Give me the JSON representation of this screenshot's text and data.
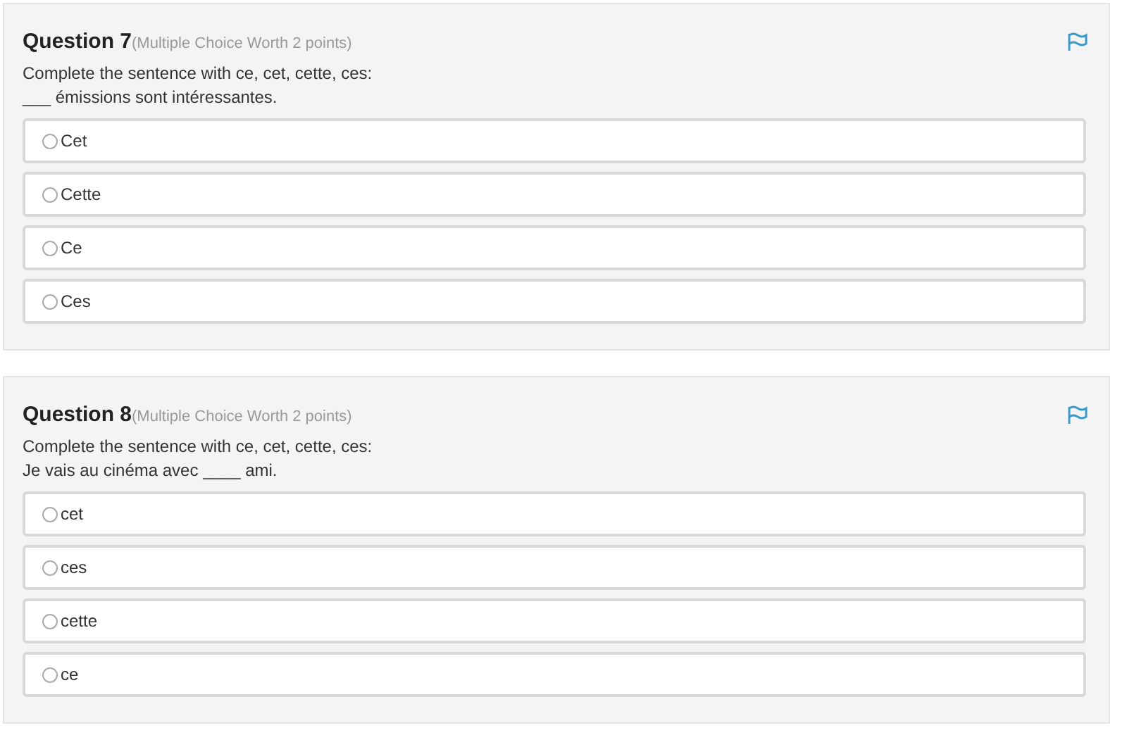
{
  "questions": [
    {
      "title": "Question 7",
      "meta": "(Multiple Choice Worth 2 points)",
      "prompt": [
        "Complete the sentence with ce, cet, cette, ces:",
        "___ émissions sont intéressantes."
      ],
      "options": [
        {
          "label": "Cet",
          "selected": false
        },
        {
          "label": "Cette",
          "selected": false
        },
        {
          "label": "Ce",
          "selected": false
        },
        {
          "label": "Ces",
          "selected": false
        }
      ]
    },
    {
      "title": "Question 8",
      "meta": "(Multiple Choice Worth 2 points)",
      "prompt": [
        "Complete the sentence with ce, cet, cette, ces:",
        "Je vais au cinéma avec ____ ami."
      ],
      "options": [
        {
          "label": "cet",
          "selected": false
        },
        {
          "label": "ces",
          "selected": false
        },
        {
          "label": "cette",
          "selected": false
        },
        {
          "label": "ce",
          "selected": false
        }
      ]
    }
  ]
}
